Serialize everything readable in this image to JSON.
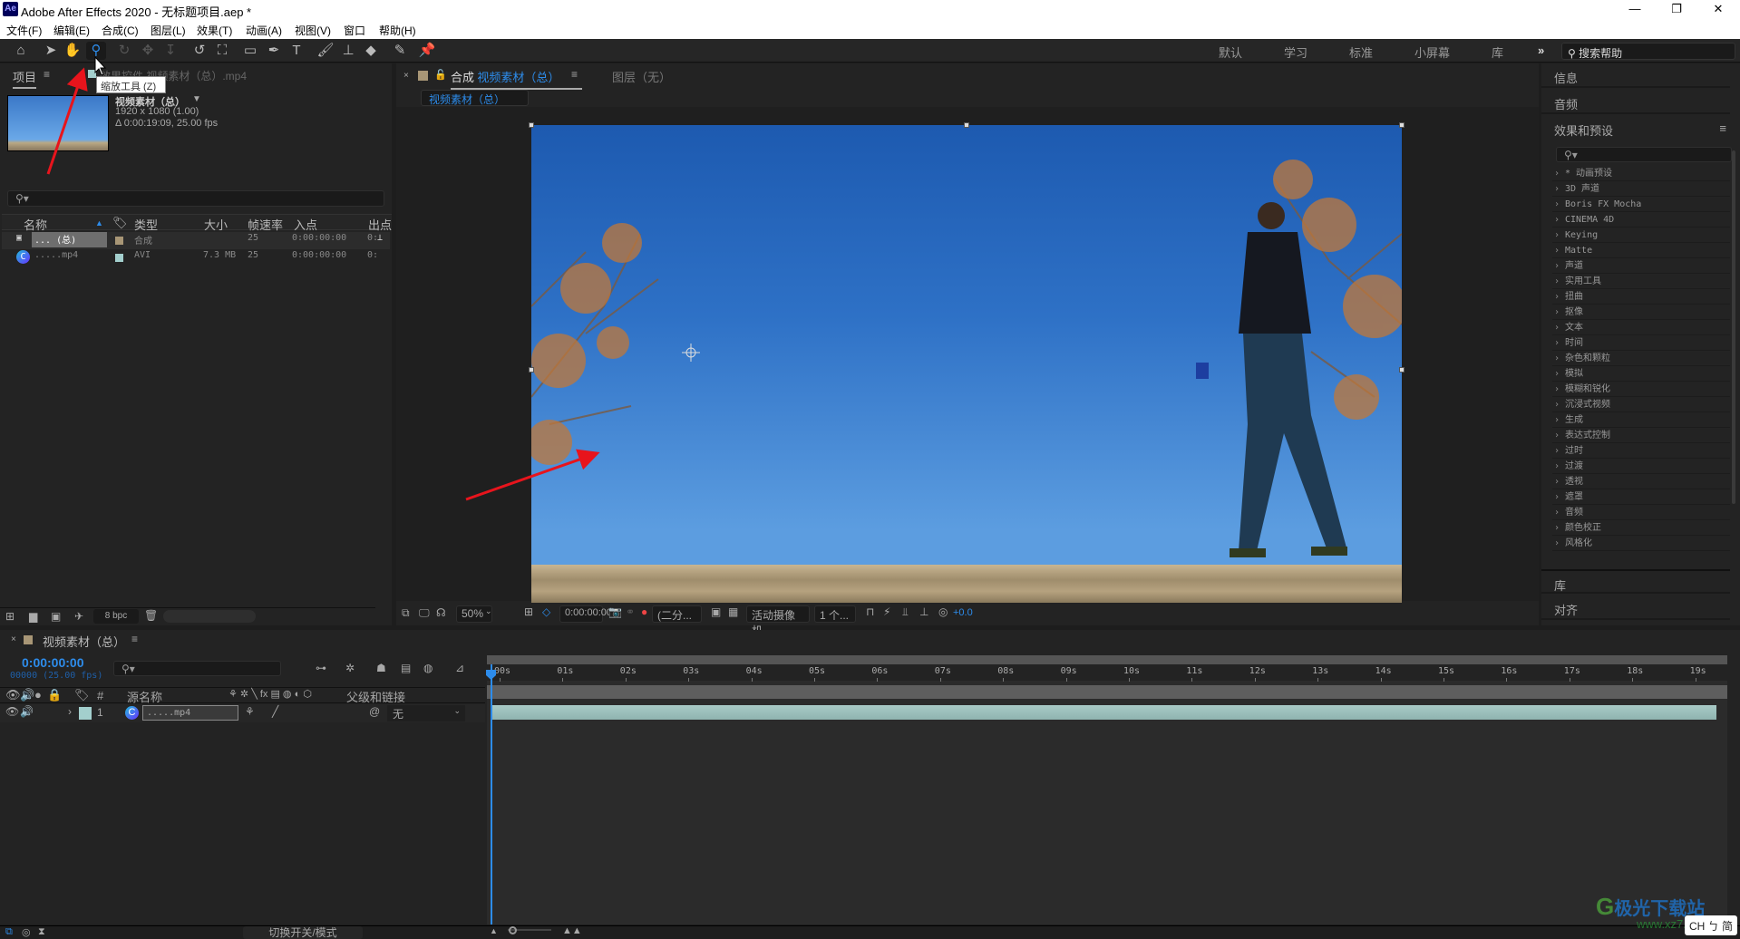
{
  "window": {
    "app_icon": "Ae",
    "title": "Adobe After Effects 2020 - 无标题项目.aep *",
    "controls": {
      "minimize": "—",
      "maximize": "❐",
      "close": "✕"
    }
  },
  "menu": [
    "文件(F)",
    "编辑(E)",
    "合成(C)",
    "图层(L)",
    "效果(T)",
    "动画(A)",
    "视图(V)",
    "窗口",
    "帮助(H)"
  ],
  "toolbar": {
    "tools": [
      "home-icon",
      "selection-icon",
      "hand-icon",
      "zoom-icon",
      "orbit-icon",
      "pan-icon",
      "dolly-icon",
      "rotate-icon",
      "anchor-icon",
      "rectangle-icon",
      "pen-icon",
      "text-icon",
      "brush-icon",
      "stamp-icon",
      "eraser-icon",
      "roto-icon",
      "puppet-icon"
    ],
    "active_tool": "zoom-icon",
    "tooltip": "缩放工具 (Z)",
    "workspaces": [
      "默认",
      "学习",
      "标准",
      "小屏幕",
      "库"
    ],
    "more": "»",
    "help_search": "搜索帮助"
  },
  "project": {
    "tab": "项目",
    "effects_tab": "效果控件 视频素材（总）.mp4",
    "selected_name": "视频素材（总）",
    "resolution": "1920 x 1080 (1.00)",
    "duration": "Δ 0:00:19:09, 25.00 fps",
    "search_placeholder": "",
    "columns": [
      "名称",
      "类型",
      "大小",
      "帧速率",
      "入点",
      "出点"
    ],
    "rows": [
      {
        "name": "... (总)",
        "color": "#a89676",
        "type": "合成",
        "size": "",
        "fps": "25",
        "in": "0:00:00:00",
        "out": "0:"
      },
      {
        "name": ".....mp4",
        "color": "#a3cfcd",
        "type": "AVI",
        "size": "7.3 MB",
        "fps": "25",
        "in": "0:00:00:00",
        "out": "0:"
      }
    ],
    "bpc": "8 bpc"
  },
  "composition": {
    "tab_prefix": "合成",
    "tab_name": "视频素材（总）",
    "layer_tab": "图层（无）",
    "breadcrumb": "视频素材（总）",
    "viewer": {
      "zoom": "50%",
      "timecode": "0:00:00:00",
      "resolution": "(二分...",
      "camera": "活动摄像机",
      "views": "1 个...",
      "exposure": "+0.0"
    }
  },
  "right_panel": {
    "info": "信息",
    "audio": "音频",
    "effects_presets": "效果和预设",
    "library": "库",
    "align": "对齐",
    "effects": [
      "* 动画预设",
      "3D 声道",
      "Boris FX Mocha",
      "CINEMA 4D",
      "Keying",
      "Matte",
      "声道",
      "实用工具",
      "扭曲",
      "抠像",
      "文本",
      "时间",
      "杂色和颗粒",
      "模拟",
      "模糊和锐化",
      "沉浸式视频",
      "生成",
      "表达式控制",
      "过时",
      "过渡",
      "透视",
      "遮罩",
      "音频",
      "颜色校正",
      "风格化"
    ]
  },
  "timeline": {
    "tab": "视频素材（总）",
    "timecode": "0:00:00:00",
    "frame_info": "00000 (25.00 fps)",
    "columns": {
      "hash": "#",
      "source": "源名称",
      "parent": "父级和链接"
    },
    "layer": {
      "index": "1",
      "name": ".....mp4",
      "parent": "无",
      "color": "#a3cfcd"
    },
    "ruler": [
      "00s",
      "01s",
      "02s",
      "03s",
      "04s",
      "05s",
      "06s",
      "07s",
      "08s",
      "09s",
      "10s",
      "11s",
      "12s",
      "13s",
      "14s",
      "15s",
      "16s",
      "17s",
      "18s",
      "19s"
    ],
    "toggle_label": "切换开关/模式"
  },
  "watermark": {
    "text": "极光下载站",
    "url": "www.xz7.com"
  },
  "ime": "CH ㄅ 简"
}
